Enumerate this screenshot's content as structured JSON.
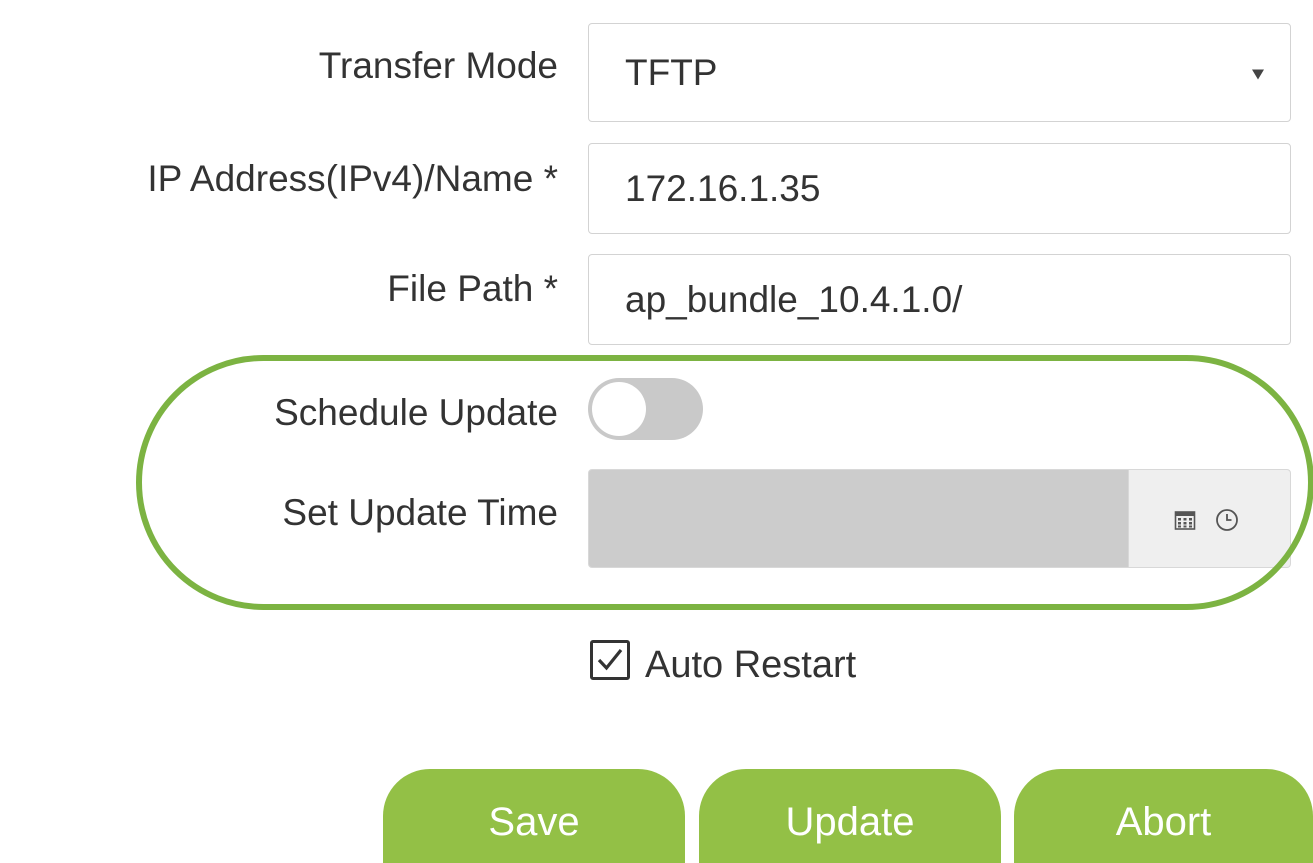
{
  "form": {
    "transfer_mode": {
      "label": "Transfer Mode",
      "value": "TFTP"
    },
    "ip_address": {
      "label": "IP Address(IPv4)/Name *",
      "value": "172.16.1.35"
    },
    "file_path": {
      "label": "File Path *",
      "value": "ap_bundle_10.4.1.0/"
    },
    "schedule_update": {
      "label": "Schedule Update",
      "enabled": false
    },
    "set_update_time": {
      "label": "Set Update Time",
      "value": ""
    },
    "auto_restart": {
      "label": "Auto Restart",
      "checked": true
    }
  },
  "buttons": {
    "save": "Save",
    "update": "Update",
    "abort": "Abort"
  },
  "icons": {
    "dropdown": "chevron-down-icon",
    "calendar": "calendar-icon",
    "clock": "clock-icon",
    "check": "check-icon"
  },
  "colors": {
    "button_bg": "#93c046",
    "highlight": "#7cb342",
    "toggle_off": "#c9c9c9",
    "disabled_field": "#cccccc"
  }
}
